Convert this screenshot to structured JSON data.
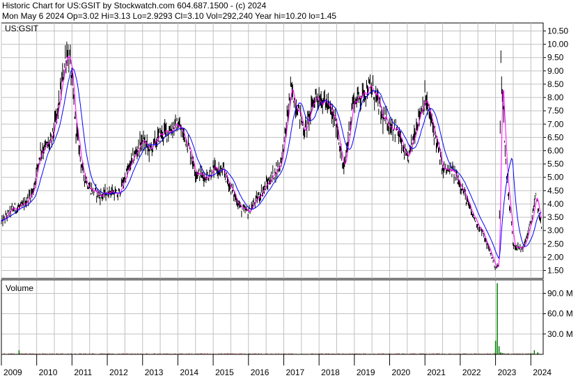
{
  "header": {
    "line1": "Historic Chart for US:GSIT by Stockwatch.com 604.687.1500 - (c) 2024",
    "line2": "Mon May  6 2024   Op=3.02  Hi=3.13  Lo=2.9293  Cl=3.10  Vol=292,240  Year hi=10.20  lo=1.45"
  },
  "colors": {
    "price": "#000000",
    "ma_short": "#ff00ff",
    "ma_long": "#0000ff",
    "volume": "#008000",
    "grid": "#c0c0c0"
  },
  "chart_data": [
    {
      "type": "line",
      "symbol": "US:GSIT",
      "ylim": [
        1.2,
        10.8
      ],
      "y_ticks": [
        "1.50",
        "2.00",
        "2.50",
        "3.00",
        "3.50",
        "4.00",
        "4.50",
        "5.00",
        "5.50",
        "6.00",
        "6.50",
        "7.00",
        "7.50",
        "8.00",
        "8.50",
        "9.00",
        "9.50",
        "10.00",
        "10.50"
      ],
      "x_ticks": [
        "2009",
        "2010",
        "2011",
        "2012",
        "2013",
        "2014",
        "2015",
        "2016",
        "2017",
        "2018",
        "2019",
        "2020",
        "2021",
        "2022",
        "2023",
        "2024"
      ],
      "x": [
        2009.0,
        2009.3,
        2009.6,
        2009.9,
        2010.1,
        2010.4,
        2010.6,
        2010.85,
        2010.95,
        2011.1,
        2011.3,
        2011.5,
        2011.8,
        2012.1,
        2012.3,
        2012.5,
        2012.8,
        2013.0,
        2013.2,
        2013.5,
        2013.8,
        2014.0,
        2014.3,
        2014.5,
        2014.8,
        2015.0,
        2015.3,
        2015.5,
        2015.8,
        2016.0,
        2016.3,
        2016.6,
        2016.9,
        2017.0,
        2017.2,
        2017.4,
        2017.6,
        2017.9,
        2018.2,
        2018.5,
        2018.7,
        2018.95,
        2019.2,
        2019.4,
        2019.6,
        2019.8,
        2020.0,
        2020.2,
        2020.5,
        2020.8,
        2021.0,
        2021.3,
        2021.5,
        2021.8,
        2022.0,
        2022.3,
        2022.6,
        2022.9,
        2023.0,
        2023.1,
        2023.15,
        2023.3,
        2023.5,
        2023.7,
        2023.8,
        2024.0,
        2024.15,
        2024.3
      ],
      "series": [
        {
          "name": "",
          "values": [
            3.3,
            3.8,
            3.9,
            4.5,
            6.0,
            6.3,
            7.5,
            9.8,
            9.3,
            7.0,
            5.2,
            4.6,
            4.3,
            4.5,
            4.3,
            5.0,
            5.9,
            6.4,
            6.0,
            6.6,
            6.8,
            7.0,
            6.2,
            5.2,
            5.0,
            5.3,
            5.2,
            4.6,
            3.8,
            3.7,
            4.3,
            4.9,
            5.5,
            6.2,
            8.3,
            7.6,
            6.7,
            8.1,
            7.8,
            7.0,
            5.2,
            7.8,
            8.1,
            8.4,
            8.1,
            7.2,
            7.0,
            6.8,
            5.6,
            7.2,
            8.0,
            6.5,
            5.3,
            5.2,
            4.8,
            3.7,
            3.0,
            2.0,
            1.6,
            1.7,
            9.5,
            5.3,
            2.5,
            2.3,
            2.4,
            3.3,
            4.3,
            3.1
          ]
        }
      ]
    },
    {
      "type": "bar",
      "title": "Volume",
      "ylim": [
        0,
        110
      ],
      "y_ticks": [
        "30.0 M",
        "60.0 M",
        "90.0 M"
      ],
      "series": [
        {
          "name": "",
          "x": [
            2009.5,
            2012.0,
            2016.0,
            2019.0,
            2021.0,
            2022.8,
            2023.0,
            2023.05,
            2023.1,
            2023.15,
            2023.2,
            2023.3,
            2023.6,
            2024.0,
            2024.1,
            2024.2
          ],
          "values": [
            6,
            1,
            1,
            1,
            1,
            1,
            20,
            105,
            12,
            3,
            2,
            1,
            1,
            2,
            6,
            3
          ]
        }
      ]
    }
  ]
}
